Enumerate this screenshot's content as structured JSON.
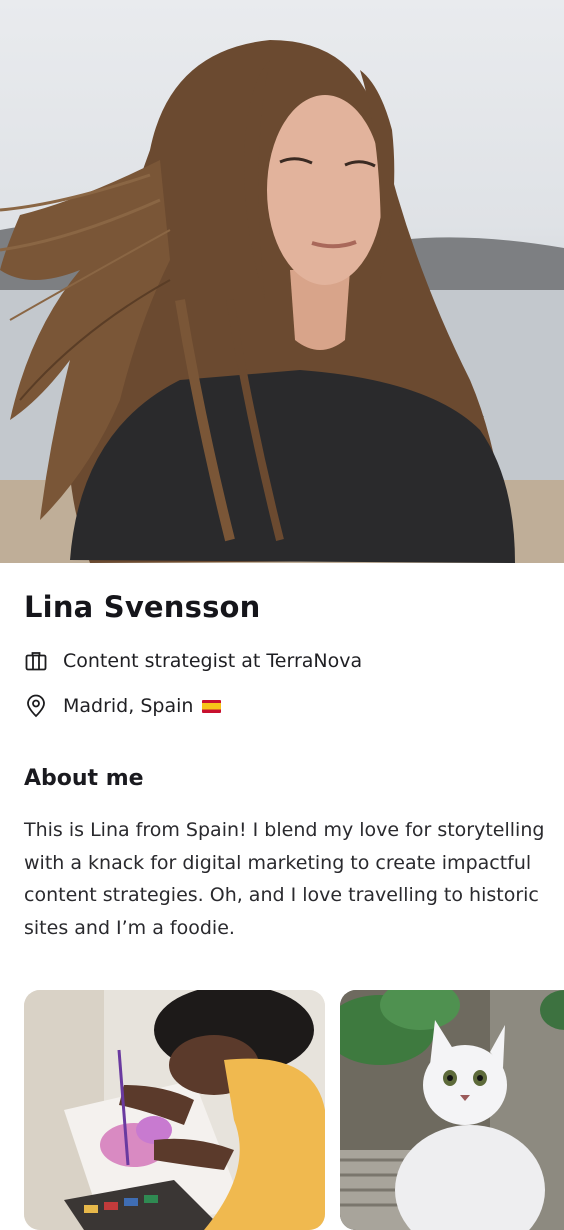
{
  "profile": {
    "name": "Lina Svensson",
    "job": "Content strategist at TerraNova",
    "location": "Madrid, Spain",
    "location_flag": "spain-flag-icon"
  },
  "about": {
    "title": "About me",
    "body": "This is Lina from Spain! I blend my love for storytelling with a knack for digital marketing to create impactful content strategies. Oh, and I love travelling to historic sites and I’m a foodie."
  },
  "icons": {
    "job": "briefcase-icon",
    "location": "location-pin-icon"
  },
  "photos": [
    {
      "subject": "person painting watercolor"
    },
    {
      "subject": "white fluffy cat"
    }
  ]
}
